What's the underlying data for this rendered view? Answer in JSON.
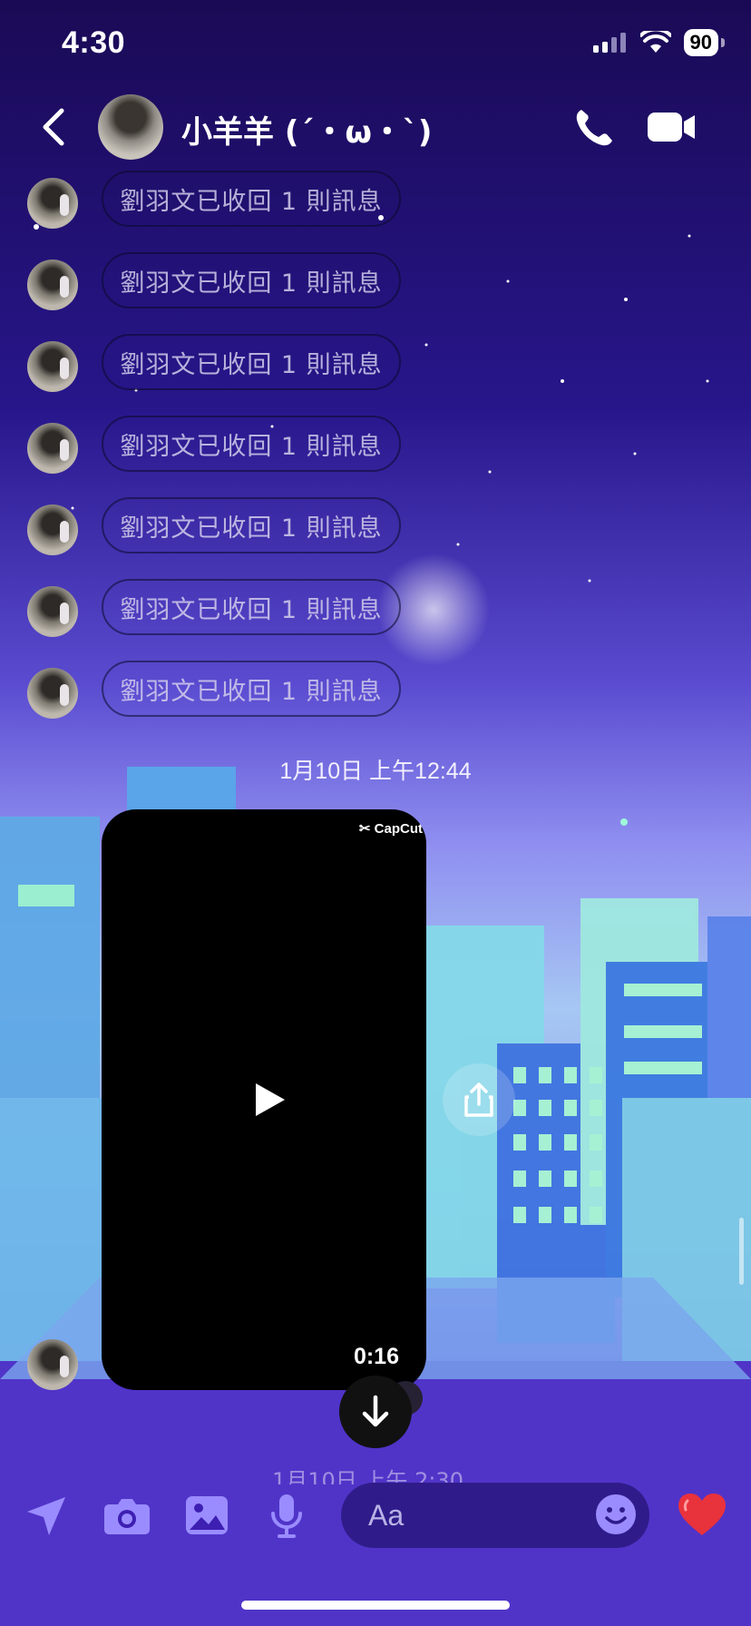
{
  "status": {
    "time": "4:30",
    "battery": "90"
  },
  "header": {
    "contact_name": "小羊羊 (´・ω・`)"
  },
  "messages": {
    "unsent": [
      "劉羽文已收回 1 則訊息",
      "劉羽文已收回 1 則訊息",
      "劉羽文已收回 1 則訊息",
      "劉羽文已收回 1 則訊息",
      "劉羽文已收回 1 則訊息",
      "劉羽文已收回 1 則訊息",
      "劉羽文已收回 1 則訊息"
    ],
    "timestamp": "1月10日 上午12:44",
    "video": {
      "watermark": "CapCut",
      "duration": "0:16"
    },
    "next_timestamp_partial": "1月10日 上午 2:30"
  },
  "composer": {
    "placeholder": "Aa"
  },
  "icons": {
    "back": "chevron-left-icon",
    "call": "phone-icon",
    "video_call": "video-camera-icon",
    "share": "share-icon",
    "play": "play-icon",
    "scroll_down": "arrow-down-icon",
    "location": "location-arrow-icon",
    "camera": "camera-icon",
    "gallery": "image-icon",
    "voice": "microphone-icon",
    "emoji": "smiley-icon",
    "like": "heart-icon"
  },
  "colors": {
    "accent": "#9a8cff",
    "like": "#e8323c",
    "background": "#1c0f5a"
  }
}
